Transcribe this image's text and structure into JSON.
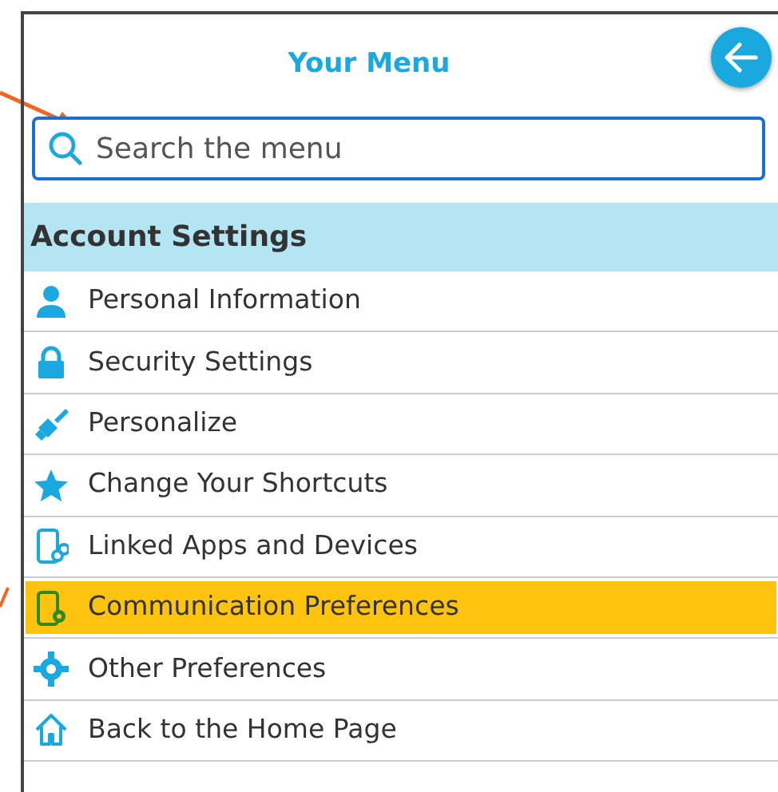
{
  "header": {
    "title": "Your Menu"
  },
  "search": {
    "placeholder": "Search the menu"
  },
  "section": {
    "title": "Account Settings"
  },
  "items": [
    {
      "label": "Personal Information",
      "selected": false
    },
    {
      "label": "Security Settings",
      "selected": false
    },
    {
      "label": "Personalize",
      "selected": false
    },
    {
      "label": "Change Your Shortcuts",
      "selected": false
    },
    {
      "label": "Linked Apps and Devices",
      "selected": false
    },
    {
      "label": "Communication Preferences",
      "selected": true
    },
    {
      "label": "Other Preferences",
      "selected": false
    },
    {
      "label": "Back to the Home Page",
      "selected": false
    }
  ]
}
